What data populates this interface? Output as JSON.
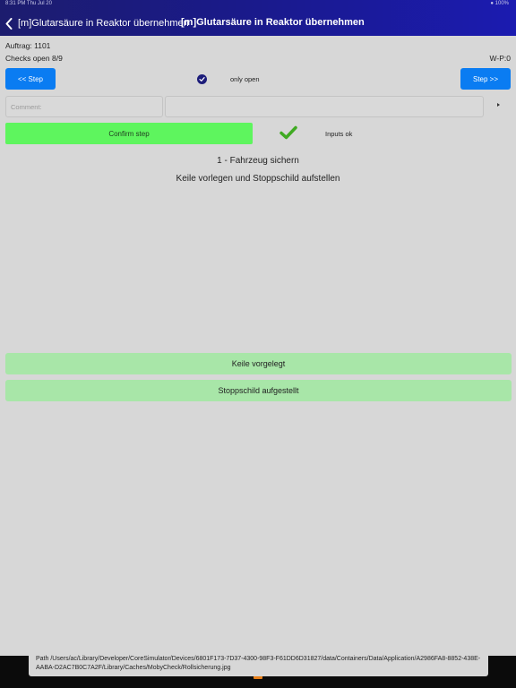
{
  "status_bar": {
    "time": "8:31 PM   Thu Jul 20",
    "right": "● 100%"
  },
  "navbar": {
    "back_label": "[m]Glutarsäure in Reaktor übernehmen",
    "title": "[m]Glutarsäure in Reaktor übernehmen"
  },
  "info": {
    "auftrag": "Auftrag: 1101",
    "checks_open": "Checks open 8/9",
    "wp": "W-P:0"
  },
  "controls": {
    "prev_label": "<< Step",
    "next_label": "Step >>",
    "only_open_label": "only open",
    "only_open_checked": true
  },
  "comment": {
    "placeholder": "Comment:",
    "value": ""
  },
  "confirm": {
    "label": "Confirm step",
    "inputs_ok_label": "Inputs ok"
  },
  "step": {
    "title": "1 - Fahrzeug sichern",
    "subtitle": "Keile vorlegen und Stoppschild aufstellen"
  },
  "answers": [
    {
      "label": "Keile vorgelegt"
    },
    {
      "label": "Stoppschild aufgestellt"
    }
  ],
  "footer": {
    "path_text": "Path /Users/ac/Library/Developer/CoreSimulator/Devices/6801F173-7D37-4300-98F3-F61DD6D31827/data/Containers/Data/Application/A2986FA8-8852-438E-AABA-D2AC7B0C7A2F/Library/Caches/MobyCheck/Rollsicherung.jpg"
  },
  "colors": {
    "navbar": "#1b1b9a",
    "blue_button": "#0a7cf2",
    "confirm_green": "#5ef55e",
    "answer_green": "#a8e6a8",
    "background": "#d7d7d7"
  },
  "icons": {
    "back": "chevron-left-icon",
    "only_open": "checkmark-circle-icon",
    "inputs_ok": "green-checkmark-icon",
    "expand": "triangle-right-icon"
  }
}
